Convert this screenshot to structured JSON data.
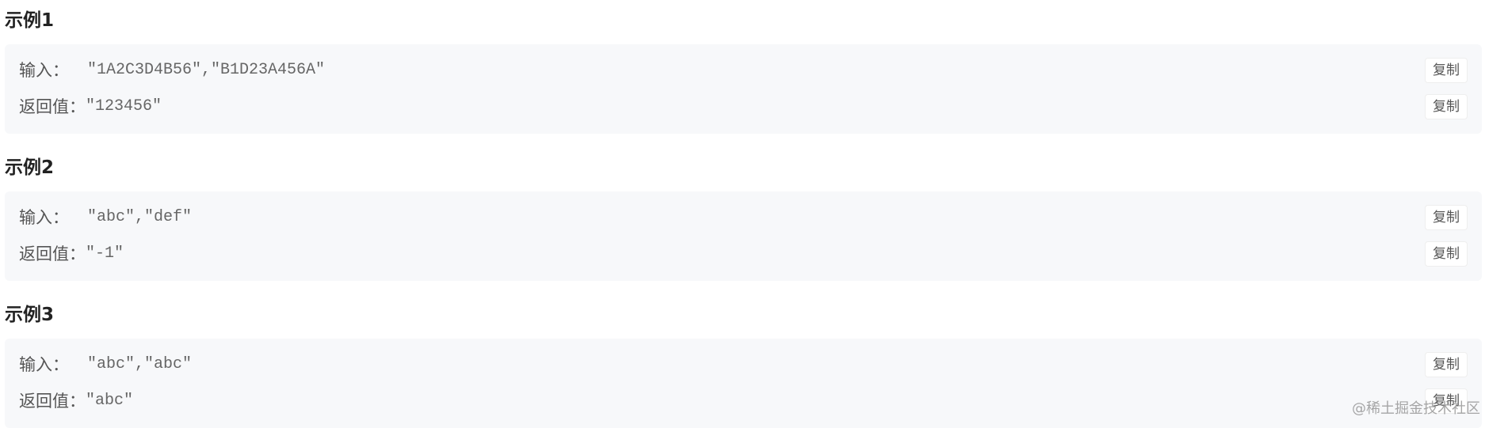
{
  "examples": [
    {
      "title": "示例1",
      "input_label": "输入：",
      "input_value": "\"1A2C3D4B56\",\"B1D23A456A\"",
      "return_label": "返回值：",
      "return_value": "\"123456\"",
      "copy_label": "复制"
    },
    {
      "title": "示例2",
      "input_label": "输入：",
      "input_value": "\"abc\",\"def\"",
      "return_label": "返回值：",
      "return_value": "\"-1\"",
      "copy_label": "复制"
    },
    {
      "title": "示例3",
      "input_label": "输入：",
      "input_value": "\"abc\",\"abc\"",
      "return_label": "返回值：",
      "return_value": "\"abc\"",
      "copy_label": "复制"
    }
  ],
  "watermark": "@稀土掘金技术社区"
}
